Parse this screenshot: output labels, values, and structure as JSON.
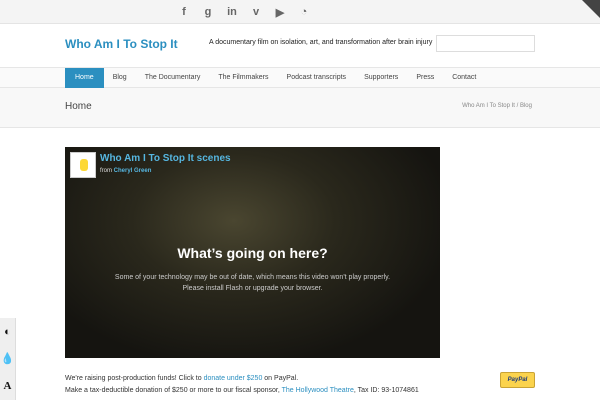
{
  "social": [
    "facebook-icon",
    "google-plus-icon",
    "linkedin-icon",
    "vimeo-icon",
    "youtube-icon",
    "rss-icon"
  ],
  "header": {
    "site_title": "Who Am I To Stop It",
    "tagline": "A documentary film on isolation, art, and transformation after brain injury",
    "search_placeholder": ""
  },
  "nav": {
    "items": [
      "Home",
      "Blog",
      "The Documentary",
      "The Filmmakers",
      "Podcast transcripts",
      "Supporters",
      "Press",
      "Contact"
    ]
  },
  "page": {
    "title": "Home",
    "breadcrumb": "Who Am I To Stop It / Blog"
  },
  "video": {
    "title": "Who Am I To Stop It scenes",
    "from_label": "from",
    "author": "Cheryl Green",
    "message_title": "What’s going on here?",
    "message_body": "Some of your technology may be out of date, which means this video won't play properly. Please install Flash or upgrade your browser."
  },
  "funds": {
    "line1_a": "We're raising post-production funds! Click to ",
    "line1_link": "donate under $250",
    "line1_b": " on PayPal.",
    "line2_a": "Make a tax-deductible donation of $250 or more to our fiscal sponsor, ",
    "line2_link": "The Hollywood Theatre",
    "line2_b": ", Tax ID: 93-1074861"
  },
  "paypal_label": "PayPal",
  "side_tools": [
    "contrast-icon",
    "drop-icon",
    "font-size-icon"
  ],
  "colors": {
    "accent": "#2b8fc0",
    "video_link": "#56b6e0"
  }
}
